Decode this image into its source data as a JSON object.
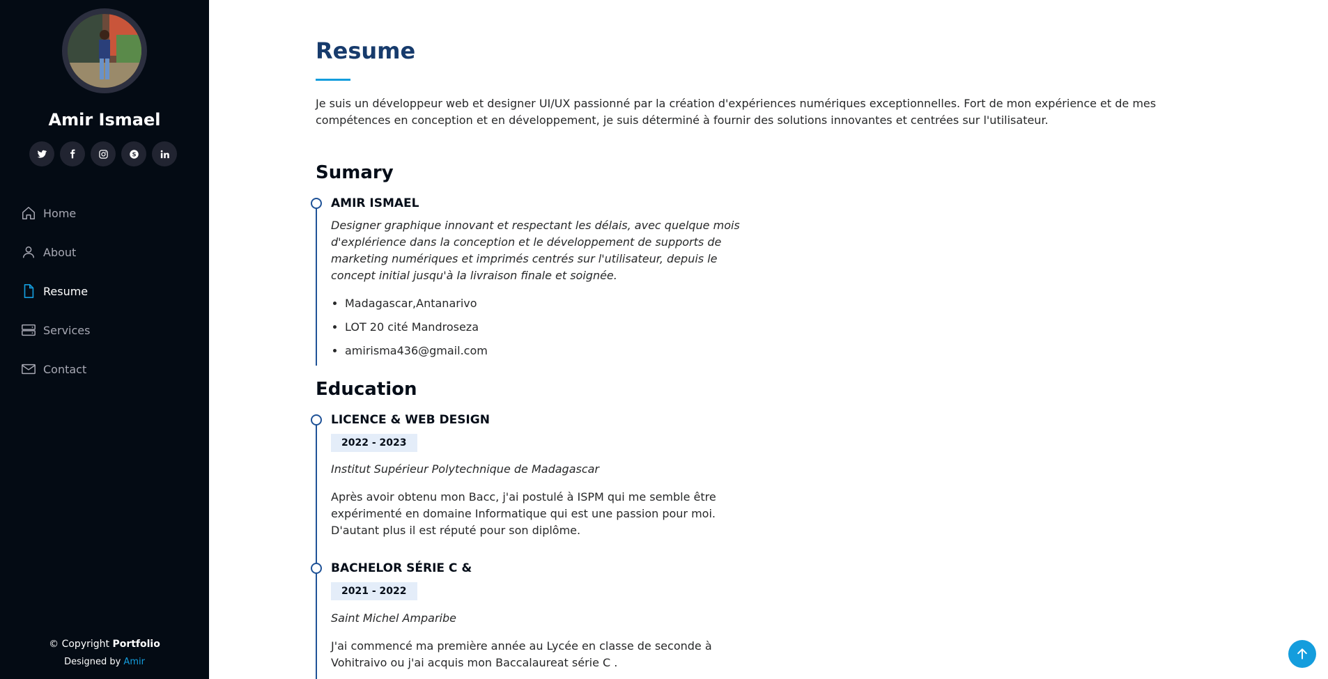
{
  "sidebar": {
    "name": "Amir Ismael",
    "social": [
      {
        "icon": "twitter-icon",
        "glyph": "🐦"
      },
      {
        "icon": "facebook-icon",
        "glyph": "f"
      },
      {
        "icon": "instagram-icon",
        "glyph": "◎"
      },
      {
        "icon": "skype-icon",
        "glyph": "S"
      },
      {
        "icon": "linkedin-icon",
        "glyph": "in"
      }
    ],
    "nav": [
      {
        "label": "Home",
        "icon": "home-icon"
      },
      {
        "label": "About",
        "icon": "user-icon"
      },
      {
        "label": "Resume",
        "icon": "file-icon",
        "active": true
      },
      {
        "label": "Services",
        "icon": "server-icon"
      },
      {
        "label": "Contact",
        "icon": "envelope-icon"
      }
    ],
    "footer": {
      "copyright_prefix": "© Copyright ",
      "brand": "Portfolio",
      "designed_by_prefix": "Designed by ",
      "designer": "Amir"
    }
  },
  "main": {
    "title": "Resume",
    "intro": "Je suis un développeur web et designer UI/UX passionné par la création d'expériences numériques exceptionnelles. Fort de mon expérience et de mes compétences en conception et en développement, je suis déterminé à fournir des solutions innovantes et centrées sur l'utilisateur.",
    "summary": {
      "heading": "Sumary",
      "name": "AMIR ISMAEL",
      "description": "Designer graphique innovant et respectant les délais, avec quelque mois d'explérience dans la conception et le développement de supports de marketing numériques et imprimés centrés sur l'utilisateur, depuis le concept initial jusqu'à la livraison finale et soignée.",
      "details": [
        "Madagascar,Antanarivo",
        "LOT 20 cité Mandroseza",
        "amirisma436@gmail.com"
      ]
    },
    "education": {
      "heading": "Education",
      "items": [
        {
          "title": "LICENCE & WEB DESIGN",
          "period": "2022 - 2023",
          "school": "Institut Supérieur Polytechnique de Madagascar",
          "text": "Après avoir obtenu mon Bacc, j'ai postulé à ISPM qui me semble être expérimenté en domaine Informatique qui est une passion pour moi. D'autant plus il est réputé pour son diplôme."
        },
        {
          "title": "BACHELOR SÉRIE C &",
          "period": "2021 - 2022",
          "school": "Saint Michel Amparibe",
          "text": "J'ai commencé ma première année au Lycée en classe de seconde à Vohitraivo ou j'ai acquis mon Baccalaureat série C ."
        }
      ]
    }
  },
  "colors": {
    "sidebar_bg": "#040b14",
    "accent": "#149ddd",
    "title": "#173b6c",
    "timeline": "#1f5297"
  }
}
